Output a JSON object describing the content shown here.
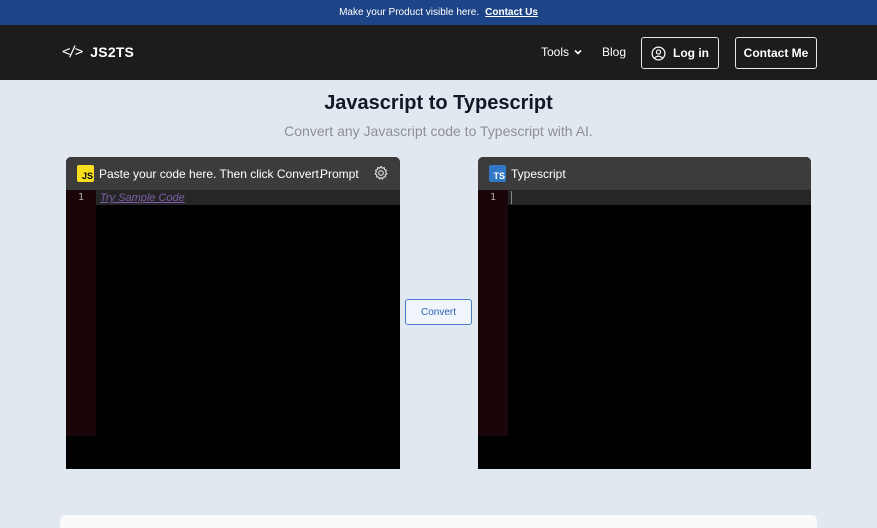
{
  "banner": {
    "text": "Make your Product visible here.",
    "link": "Contact Us"
  },
  "nav": {
    "logo_icon": "</>",
    "logo_text": "JS2TS",
    "tools": "Tools",
    "blog": "Blog",
    "login": "Log in",
    "contact": "Contact Me"
  },
  "hero": {
    "title": "Javascript to Typescript",
    "subtitle": "Convert any Javascript code to Typescript with AI."
  },
  "input_panel": {
    "badge": "JS",
    "header": "Paste your code here. Then click Convert.",
    "prompt": "Prompt",
    "line_number": "1",
    "sample_link": "Try Sample Code"
  },
  "output_panel": {
    "badge": "TS",
    "header": "Typescript",
    "line_number": "1"
  },
  "convert_button": "Convert",
  "colors": {
    "banner": "#1d4486",
    "nav": "#1c1c1c",
    "accent": "#3178c6",
    "js_yellow": "#f7df1e"
  }
}
